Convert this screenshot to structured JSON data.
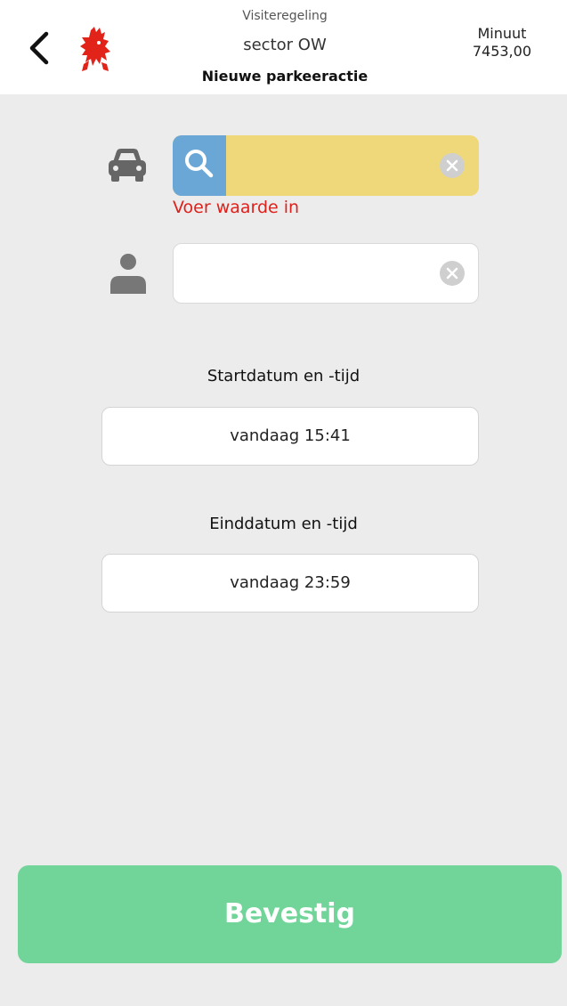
{
  "header": {
    "subtitle": "Visiteregeling",
    "sector": "sector OW",
    "title": "Nieuwe parkeeractie",
    "unit_label": "Minuut",
    "balance": "7453,00",
    "back_icon": "chevron-left-icon",
    "logo_icon": "red-lion-crest-icon"
  },
  "plate_field": {
    "value": "",
    "error": "Voer waarde in",
    "icon": "car-icon",
    "search_icon": "search-icon",
    "clear_icon": "clear-icon",
    "background_color": "#efd87a",
    "search_color": "#6aa7d6"
  },
  "name_field": {
    "value": "",
    "icon": "person-icon",
    "clear_icon": "clear-icon"
  },
  "start": {
    "label": "Startdatum en -tijd",
    "value": "vandaag 15:41"
  },
  "end": {
    "label": "Einddatum en -tijd",
    "value": "vandaag 23:59"
  },
  "confirm": {
    "label": "Bevestig",
    "color": "#71d59a"
  },
  "colors": {
    "error": "#e0201b",
    "background": "#ececec"
  }
}
